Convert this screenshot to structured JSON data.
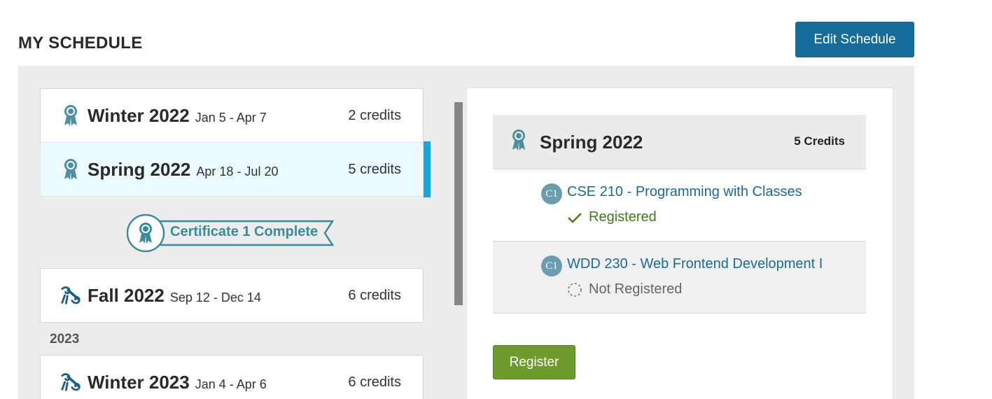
{
  "page": {
    "title": "MY SCHEDULE"
  },
  "toolbar": {
    "edit_label": "Edit Schedule"
  },
  "terms": [
    {
      "name": "Winter 2022",
      "dates": "Jan 5 - Apr 7",
      "credits": "2 credits",
      "icon": "award-ribbon-icon",
      "selected": false
    },
    {
      "name": "Spring 2022",
      "dates": "Apr 18 - Jul 20",
      "credits": "5 credits",
      "icon": "award-ribbon-icon",
      "selected": true
    },
    {
      "name": "Fall 2022",
      "dates": "Sep 12 - Dec 14",
      "credits": "6 credits",
      "icon": "diploma-scroll-icon",
      "selected": false
    },
    {
      "name": "Winter 2023",
      "dates": "Jan 4 - Apr 6",
      "credits": "6 credits",
      "icon": "diploma-scroll-icon",
      "selected": false
    }
  ],
  "certificate": {
    "label": "Certificate 1 Complete",
    "icon": "award-ribbon-icon"
  },
  "year_divider": "2023",
  "detail": {
    "term": "Spring 2022",
    "credits": "5 Credits",
    "courses": [
      {
        "badge": "C1",
        "title": "CSE 210 - Programming with Classes",
        "status": "Registered",
        "status_icon": "checkmark-icon"
      },
      {
        "badge": "C1",
        "title": "WDD 230 - Web Frontend Development I",
        "status": "Not Registered",
        "status_icon": "dashed-circle-icon"
      }
    ],
    "register_label": "Register"
  },
  "colors": {
    "primary_blue": "#156b99",
    "selected_accent": "#1aa6d8",
    "teal": "#3a8c9a",
    "registered_green": "#3f7d1c",
    "register_button": "#6d9b2c"
  }
}
